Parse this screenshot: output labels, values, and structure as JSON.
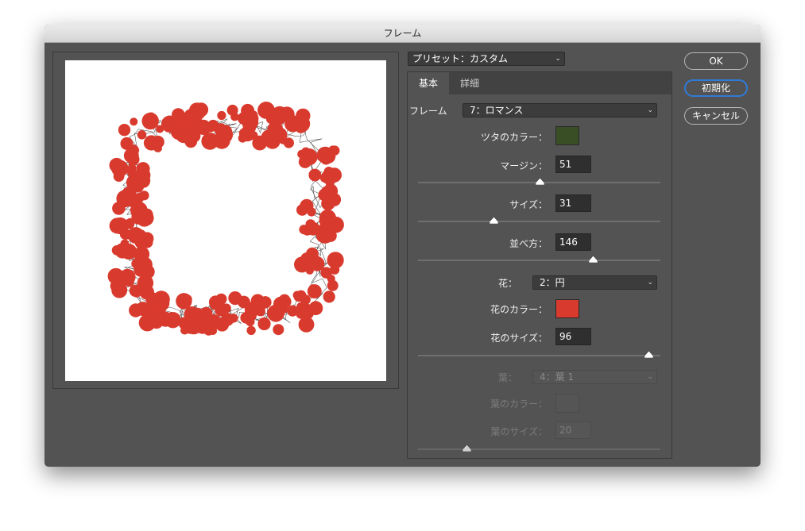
{
  "window": {
    "title": "フレーム"
  },
  "preset": {
    "label": "プリセット：カスタム"
  },
  "tabs": [
    {
      "label": "基本",
      "active": true
    },
    {
      "label": "詳細",
      "active": false
    }
  ],
  "frame": {
    "label": "フレーム",
    "value": "7：ロマンス"
  },
  "vine_color": {
    "label": "ツタのカラー：",
    "hex": "#3a4e26"
  },
  "margin": {
    "label": "マージン：",
    "value": "51",
    "slider_fraction": 0.5
  },
  "size": {
    "label": "サイズ：",
    "value": "31",
    "slider_fraction": 0.31
  },
  "arrangement": {
    "label": "並べ方：",
    "value": "146",
    "slider_fraction": 0.72
  },
  "flower": {
    "label": "花：",
    "value": "2：円"
  },
  "flower_color": {
    "label": "花のカラー：",
    "hex": "#d93a2e"
  },
  "flower_size": {
    "label": "花のサイズ：",
    "value": "96",
    "slider_fraction": 0.95
  },
  "leaf": {
    "label": "葉：",
    "value": "4：葉 1"
  },
  "leaf_color": {
    "label": "葉のカラー："
  },
  "leaf_size": {
    "label": "葉のサイズ：",
    "value": "20",
    "slider_fraction": 0.2
  },
  "buttons": {
    "ok": "OK",
    "reset": "初期化",
    "cancel": "キャンセル"
  },
  "colors": {
    "dialog_bg": "#535353",
    "accent_focus": "#2f7bd8",
    "flower_red": "#d93a2e"
  }
}
